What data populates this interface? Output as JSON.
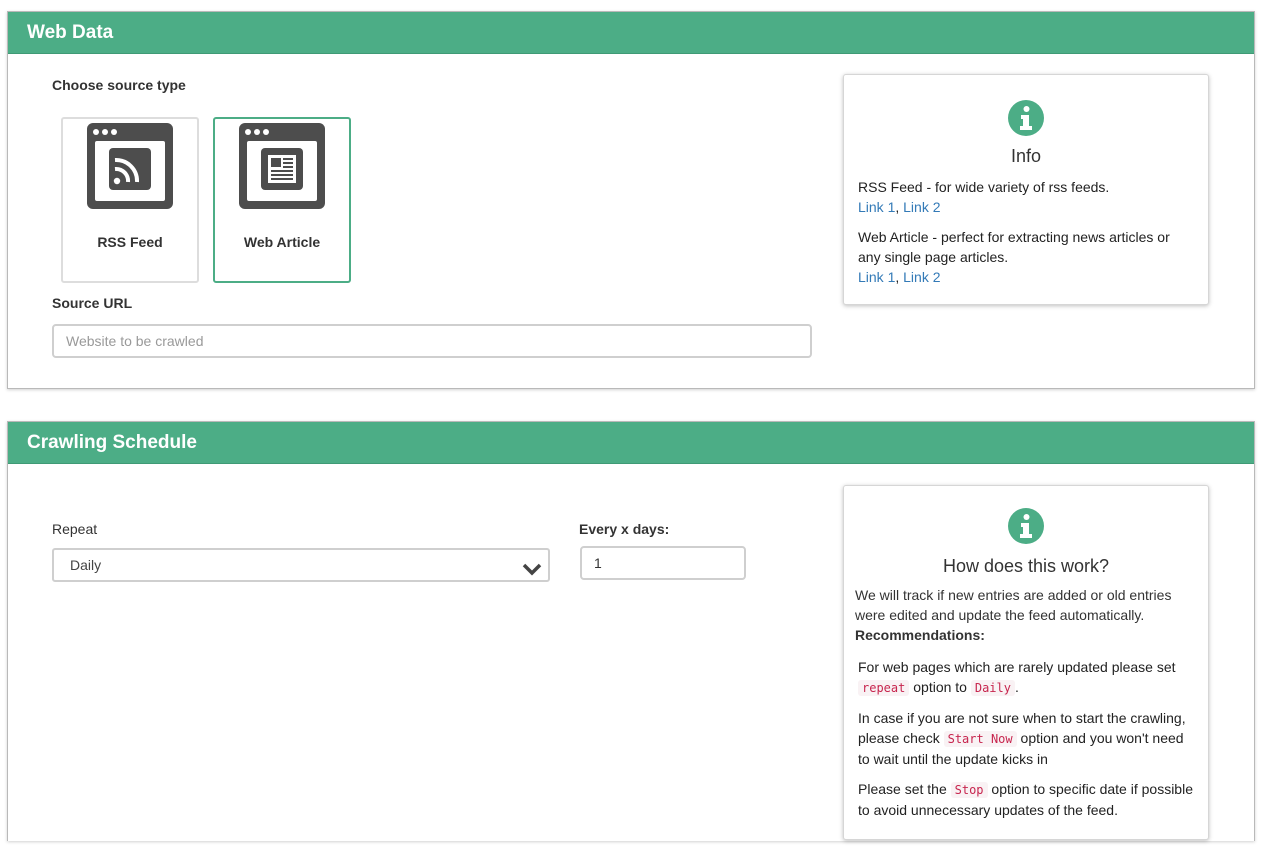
{
  "web_data": {
    "title": "Web Data",
    "choose_label": "Choose source type",
    "sources": [
      {
        "label": "RSS Feed",
        "icon": "rss-icon",
        "selected": false
      },
      {
        "label": "Web Article",
        "icon": "newspaper-icon",
        "selected": true
      }
    ],
    "source_url_label": "Source URL",
    "source_url_placeholder": "Website to be crawled",
    "source_url_value": "",
    "info": {
      "title": "Info",
      "rss_text": "RSS Feed - for wide variety of rss feeds.",
      "rss_links": [
        "Link 1",
        "Link 2"
      ],
      "article_text": "Web Article - perfect for extracting news articles or any single page articles.",
      "article_links": [
        "Link 1",
        "Link 2"
      ],
      "link_separator": ","
    }
  },
  "schedule": {
    "title": "Crawling Schedule",
    "repeat_label": "Repeat",
    "repeat_value": "Daily",
    "every_label": "Every x days:",
    "every_value": "1",
    "info": {
      "title": "How does this work?",
      "intro": "We will track if new entries are added or old entries were edited and update the feed automatically.",
      "recommendations_label": "Recommendations:",
      "rec1_a": "For web pages which are rarely updated please set",
      "rec1_code1": "repeat",
      "rec1_b": "option to",
      "rec1_code2": "Daily",
      "rec1_c": ".",
      "rec2_a": "In case if you are not sure when to start the crawling, please check",
      "rec2_code": "Start Now",
      "rec2_b": "option and you won't need to wait until the update kicks in",
      "rec3_a": "Please set the",
      "rec3_code": "Stop",
      "rec3_b": "option to specific date if possible to avoid unnecessary updates of the feed."
    }
  },
  "colors": {
    "accent": "#4cad86",
    "link": "#337ab7",
    "code": "#c7254e",
    "icon_dark": "#555555"
  }
}
